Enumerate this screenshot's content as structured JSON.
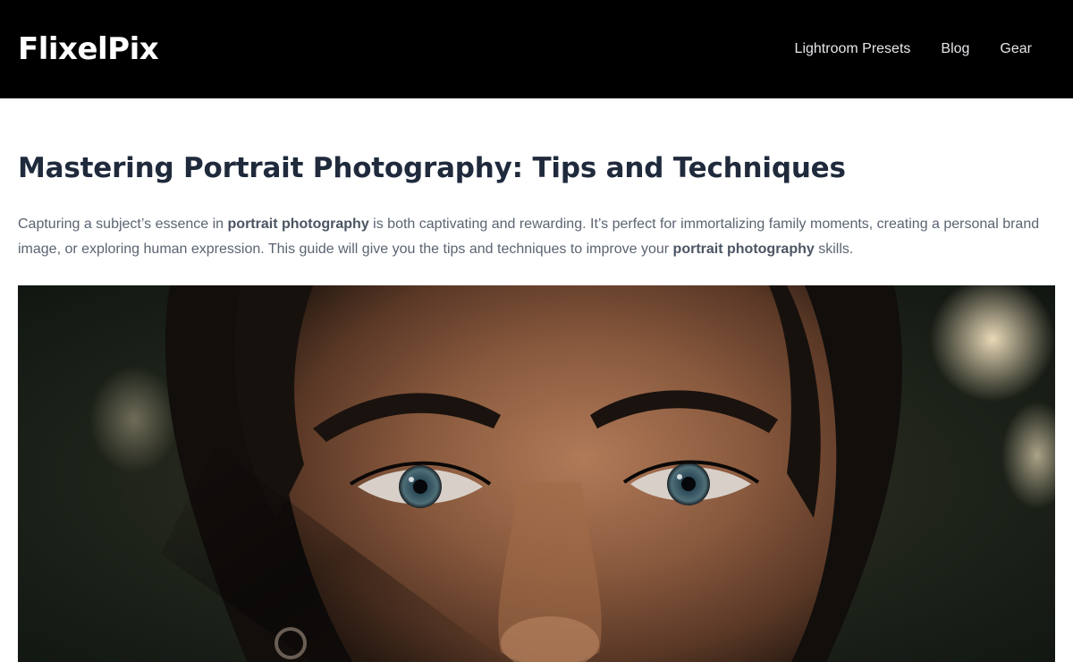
{
  "header": {
    "logo": "FlixelPix",
    "nav": [
      {
        "label": "Lightroom Presets"
      },
      {
        "label": "Blog"
      },
      {
        "label": "Gear"
      }
    ]
  },
  "article": {
    "title": "Mastering Portrait Photography: Tips and Techniques",
    "intro": {
      "p1": "Capturing a subject’s essence in ",
      "k1": "portrait photography",
      "p2": " is both captivating and rewarding. It’s perfect for immortalizing family moments, creating a personal brand image, or exploring human expression. This guide will give you the tips and techniques to improve your ",
      "k2": "portrait photography",
      "p3": " skills."
    }
  },
  "colors": {
    "header_bg": "#000000",
    "title": "#1f2a3c",
    "body_text": "#5b6472"
  }
}
